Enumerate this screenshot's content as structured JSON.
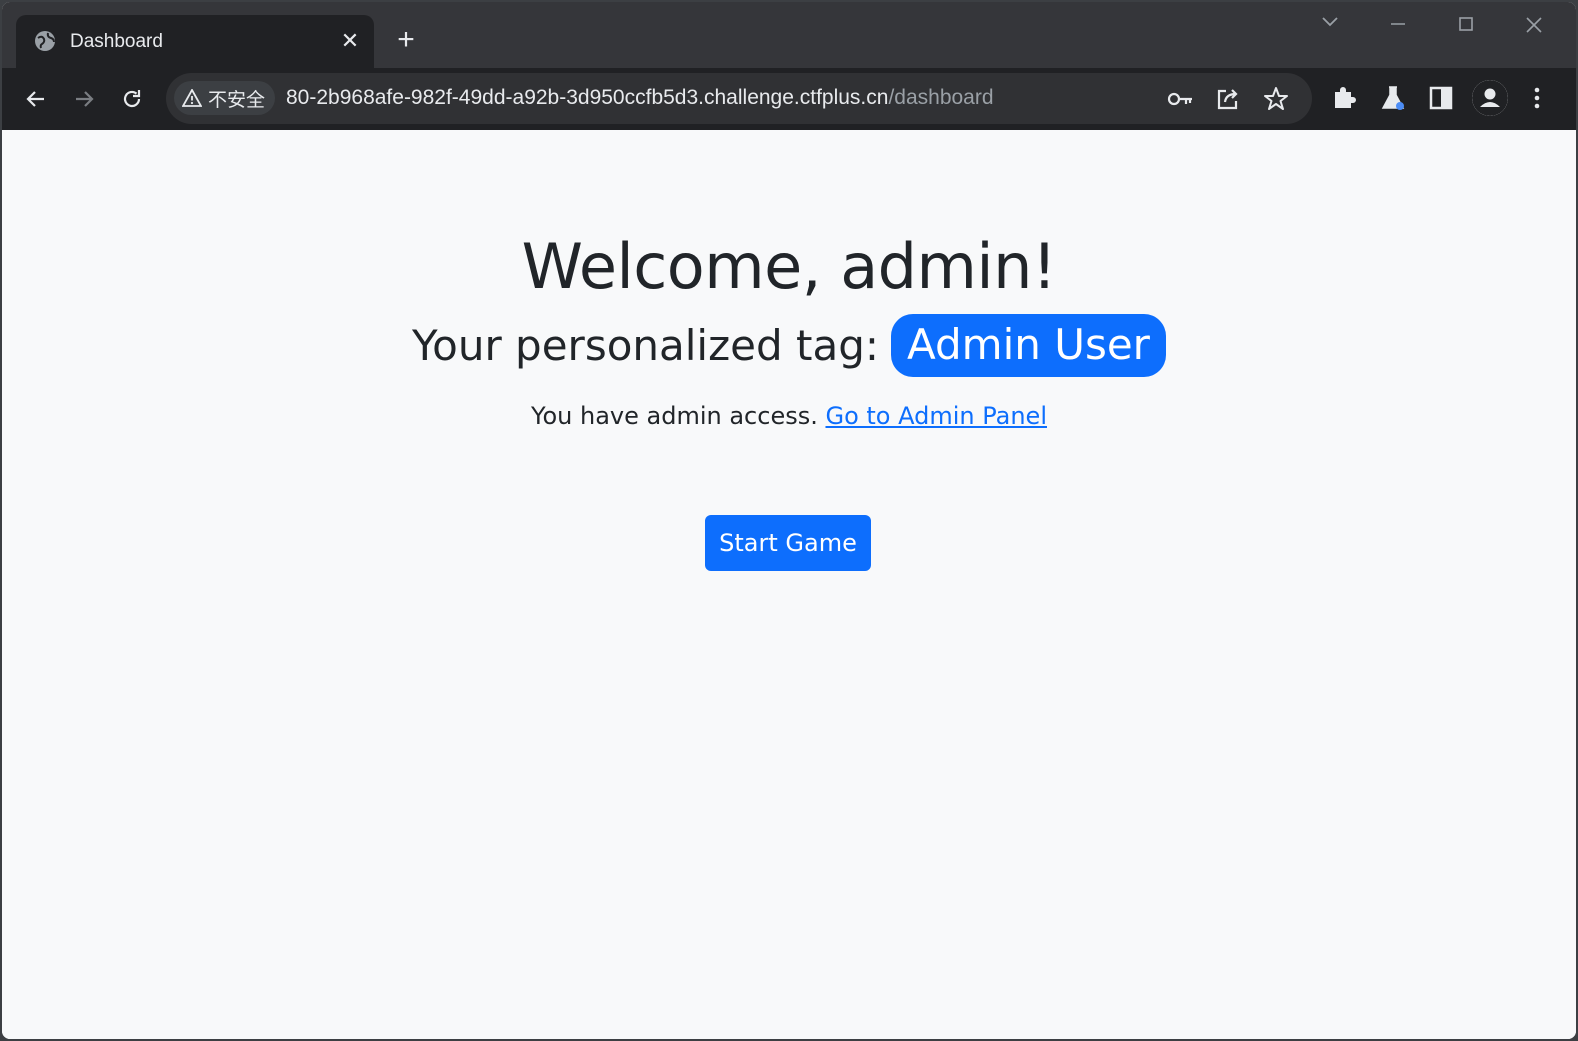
{
  "browser": {
    "tab_title": "Dashboard",
    "security_label": "不安全",
    "url_host": "80-2b968afe-982f-49dd-a92b-3d950ccfb5d3.challenge.ctfplus.cn",
    "url_path": "/dashboard",
    "close_glyph": "✕",
    "newtab_glyph": "+"
  },
  "page": {
    "welcome": "Welcome, admin!",
    "tag_label": "Your personalized tag:",
    "tag_value": "Admin User",
    "access_text": "You have admin access.",
    "admin_link": "Go to Admin Panel",
    "start_button": "Start Game"
  },
  "colors": {
    "primary": "#0d6efd",
    "text": "#212529",
    "page_bg": "#f8f9fa",
    "chrome_dark": "#202124"
  }
}
